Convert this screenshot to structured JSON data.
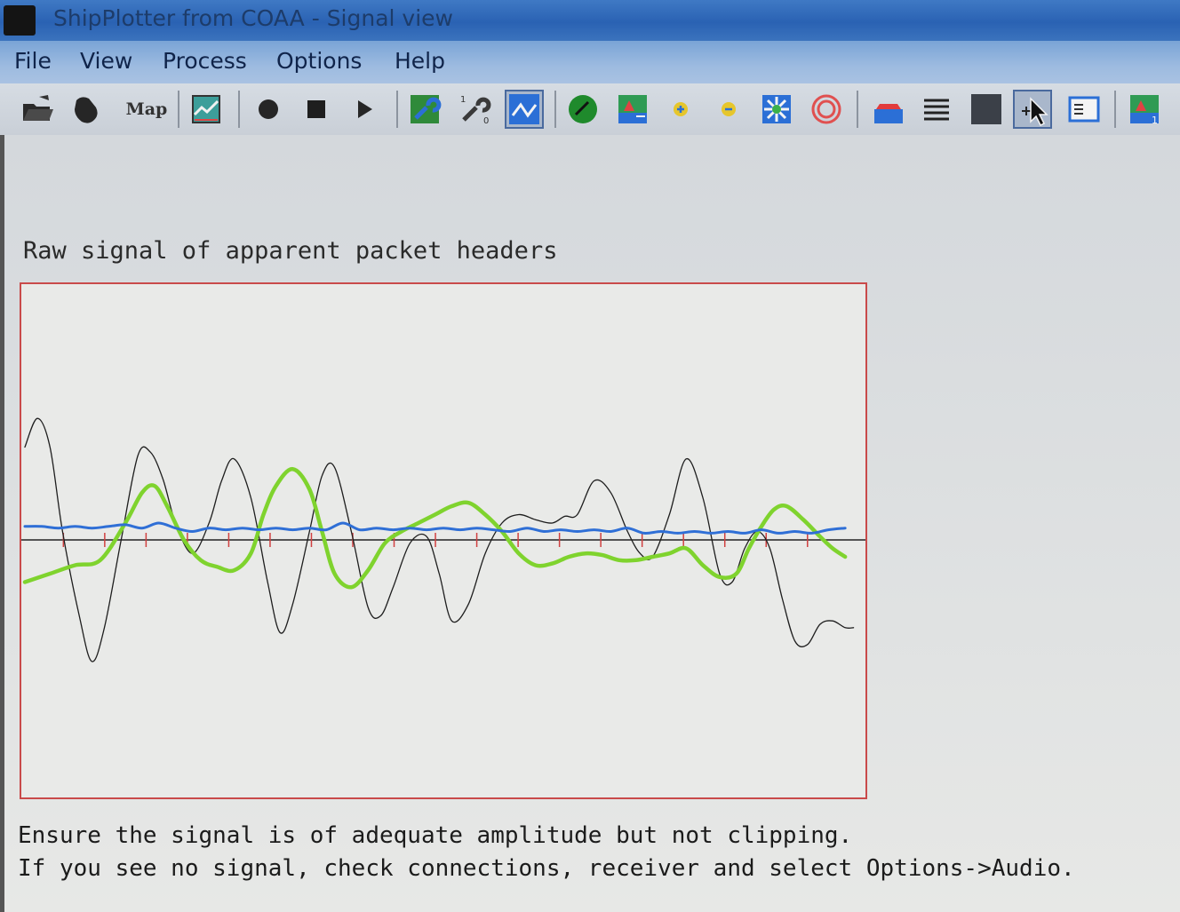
{
  "window": {
    "title": "ShipPlotter from COAA - Signal view"
  },
  "menu": {
    "items": [
      "File",
      "View",
      "Process",
      "Options",
      "Help"
    ]
  },
  "toolbar": {
    "buttons": [
      {
        "name": "open-folder-icon"
      },
      {
        "name": "hand-icon"
      },
      {
        "name": "map-text-icon",
        "label": "Map"
      },
      {
        "name": "chart-image-icon"
      },
      {
        "name": "record-icon"
      },
      {
        "name": "stop-icon"
      },
      {
        "name": "play-icon"
      },
      {
        "name": "tools-wrench-icon"
      },
      {
        "name": "tools-numbered-icon"
      },
      {
        "name": "signal-view-icon",
        "pressed": true
      },
      {
        "name": "green-disc-icon"
      },
      {
        "name": "ship-map-icon"
      },
      {
        "name": "zoom-in-icon"
      },
      {
        "name": "zoom-out-icon"
      },
      {
        "name": "map-target-icon"
      },
      {
        "name": "range-rings-icon"
      },
      {
        "name": "boat-icon"
      },
      {
        "name": "list-lines-icon"
      },
      {
        "name": "dark-panel-icon"
      },
      {
        "name": "pointer-icon"
      },
      {
        "name": "window-info-icon"
      },
      {
        "name": "ship-map-numbered-icon"
      }
    ]
  },
  "signal_view": {
    "plot_title": "Raw signal of apparent packet headers",
    "status_line_1": "Ensure the signal is of adequate amplitude but not clipping.",
    "status_line_2": "If you see no signal, check connections, receiver and select Options->Audio."
  },
  "colors": {
    "titlebar": "#2a62b3",
    "plot_border": "#c94a4a",
    "axis": "#222222",
    "ticks": "#d04040",
    "raw_signal": "#1e1e1e",
    "filtered_signal": "#7fd32e",
    "baseline_signal": "#2f6fd6"
  },
  "chart_data": {
    "type": "line",
    "title": "Raw signal of apparent packet headers",
    "xlabel": "",
    "ylabel": "",
    "grid": false,
    "xlim": [
      0,
      100
    ],
    "ylim": [
      -1.0,
      1.0
    ],
    "tick_count": 19,
    "series": [
      {
        "color": "#1e1e1e",
        "width": 1.3,
        "x": [
          0,
          1.5,
          3,
          4.5,
          6.5,
          8,
          9.5,
          11.5,
          13.5,
          15,
          16.5,
          18,
          20,
          22,
          23.5,
          25,
          27,
          29,
          30.5,
          32,
          34,
          35.5,
          37,
          39,
          41,
          42.5,
          44,
          46,
          48,
          49.5,
          51,
          53,
          55,
          57,
          59,
          61,
          63,
          64.5,
          66,
          68,
          70,
          72,
          73.5,
          75,
          77,
          79,
          81,
          83,
          84.5,
          86,
          87.5,
          89,
          90.5,
          92,
          93.5,
          95,
          96.5,
          98,
          99
        ],
        "y": [
          0.55,
          0.72,
          0.55,
          0.05,
          -0.45,
          -0.72,
          -0.52,
          0.0,
          0.5,
          0.52,
          0.36,
          0.1,
          -0.08,
          0.1,
          0.35,
          0.48,
          0.25,
          -0.25,
          -0.55,
          -0.38,
          0.05,
          0.38,
          0.43,
          0.05,
          -0.4,
          -0.45,
          -0.28,
          -0.02,
          0.02,
          -0.2,
          -0.48,
          -0.38,
          -0.08,
          0.1,
          0.15,
          0.12,
          0.1,
          0.14,
          0.15,
          0.35,
          0.28,
          0.05,
          -0.08,
          -0.1,
          0.15,
          0.48,
          0.25,
          -0.2,
          -0.25,
          -0.05,
          0.05,
          -0.05,
          -0.35,
          -0.6,
          -0.62,
          -0.5,
          -0.48,
          -0.52,
          -0.52
        ]
      },
      {
        "color": "#7fd32e",
        "width": 4.5,
        "x": [
          0,
          3,
          6,
          9,
          12,
          14,
          15.5,
          17,
          19,
          21,
          23,
          25,
          27,
          28.5,
          30,
          32,
          34,
          35.5,
          37,
          39,
          41,
          43,
          45,
          47,
          49,
          51,
          53,
          55,
          57,
          59,
          61,
          63,
          65,
          67,
          69,
          71,
          73,
          75,
          77,
          79,
          81,
          83,
          85,
          86.5,
          88,
          89.5,
          91,
          93,
          95,
          96.5,
          98
        ],
        "y": [
          -0.25,
          -0.2,
          -0.15,
          -0.12,
          0.1,
          0.28,
          0.32,
          0.2,
          0.0,
          -0.12,
          -0.16,
          -0.18,
          -0.08,
          0.15,
          0.32,
          0.42,
          0.3,
          0.05,
          -0.2,
          -0.28,
          -0.18,
          -0.02,
          0.05,
          0.1,
          0.15,
          0.2,
          0.22,
          0.15,
          0.05,
          -0.08,
          -0.15,
          -0.14,
          -0.1,
          -0.08,
          -0.09,
          -0.12,
          -0.12,
          -0.1,
          -0.08,
          -0.05,
          -0.15,
          -0.22,
          -0.2,
          -0.05,
          0.08,
          0.18,
          0.2,
          0.12,
          0.02,
          -0.05,
          -0.1
        ]
      },
      {
        "color": "#2f6fd6",
        "width": 3,
        "x": [
          0,
          2,
          4,
          6,
          8,
          10,
          12,
          14,
          16,
          18,
          20,
          22,
          24,
          26,
          28,
          30,
          32,
          34,
          36,
          38,
          40,
          42,
          44,
          46,
          48,
          50,
          52,
          54,
          56,
          58,
          60,
          62,
          64,
          66,
          68,
          70,
          72,
          74,
          76,
          78,
          80,
          82,
          84,
          86,
          88,
          90,
          92,
          94,
          96,
          98
        ],
        "y": [
          0.08,
          0.08,
          0.07,
          0.08,
          0.07,
          0.08,
          0.09,
          0.07,
          0.1,
          0.07,
          0.05,
          0.07,
          0.06,
          0.07,
          0.06,
          0.07,
          0.06,
          0.07,
          0.06,
          0.1,
          0.06,
          0.07,
          0.06,
          0.07,
          0.06,
          0.07,
          0.06,
          0.07,
          0.06,
          0.05,
          0.07,
          0.05,
          0.06,
          0.05,
          0.06,
          0.05,
          0.07,
          0.04,
          0.05,
          0.04,
          0.05,
          0.04,
          0.05,
          0.04,
          0.06,
          0.04,
          0.05,
          0.04,
          0.06,
          0.07
        ]
      }
    ]
  }
}
